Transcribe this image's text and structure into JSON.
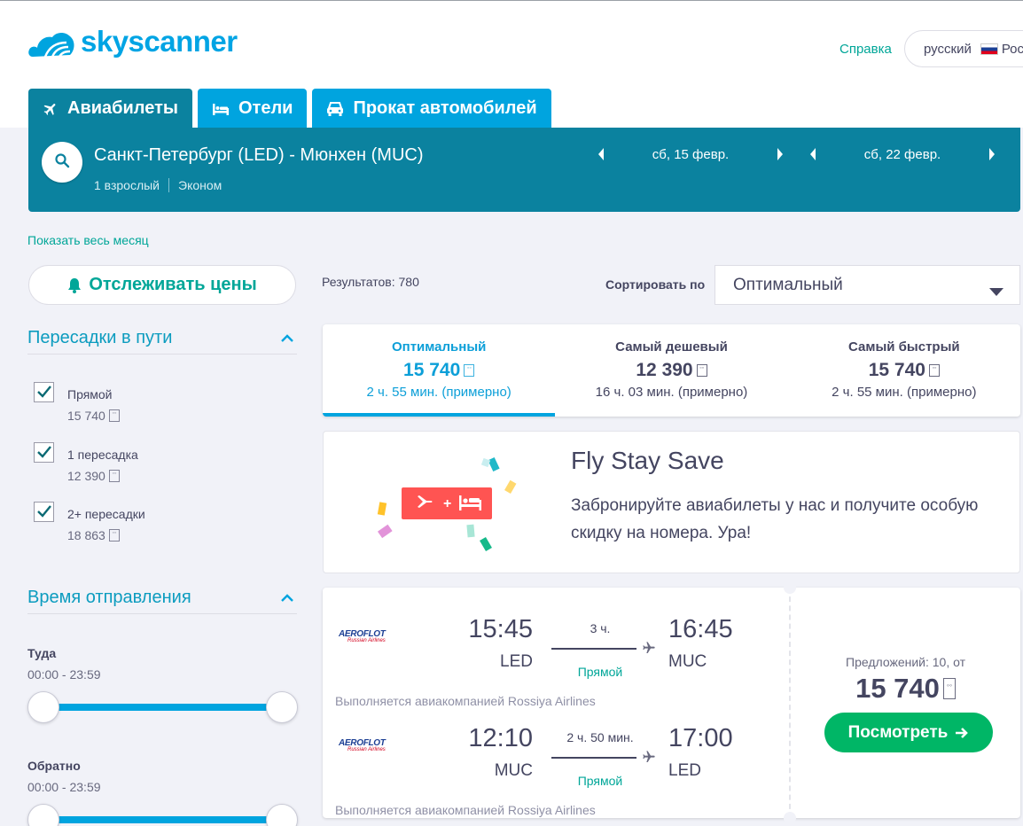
{
  "header": {
    "logo_text": "skyscanner",
    "help_link": "Справка",
    "language": "русский",
    "country_partial": "Рос"
  },
  "tabs": [
    {
      "label": "Авиабилеты",
      "icon": "plane-icon",
      "active": true
    },
    {
      "label": "Отели",
      "icon": "bed-icon",
      "active": false
    },
    {
      "label": "Прокат автомобилей",
      "icon": "car-icon",
      "active": false
    }
  ],
  "search": {
    "route": "Санкт-Петербург (LED) - Мюнхен (MUC)",
    "passengers": "1 взрослый",
    "cabin": "Эконом",
    "depart_date": "сб, 15 февр.",
    "return_date": "сб, 22 февр."
  },
  "show_month_link": "Показать весь месяц",
  "track_prices_button": "Отслеживать цены",
  "filters": {
    "stops": {
      "title": "Пересадки в пути",
      "options": [
        {
          "label": "Прямой",
          "price": "15 740",
          "checked": true
        },
        {
          "label": "1 пересадка",
          "price": "12 390",
          "checked": true
        },
        {
          "label": "2+ пересадки",
          "price": "18 863",
          "checked": true
        }
      ]
    },
    "departure_time": {
      "title": "Время отправления",
      "outbound_label": "Туда",
      "outbound_range": "00:00 - 23:59",
      "return_label": "Обратно",
      "return_range": "00:00 - 23:59"
    }
  },
  "results": {
    "count_text": "Результатов: 780",
    "sort_label": "Сортировать по",
    "sort_value": "Оптимальный"
  },
  "sort_tabs": [
    {
      "title": "Оптимальный",
      "price": "15 740",
      "duration": "2 ч. 55 мин. (примерно)",
      "active": true
    },
    {
      "title": "Самый дешевый",
      "price": "12 390",
      "duration": "16 ч. 03 мин. (примерно)",
      "active": false
    },
    {
      "title": "Самый быстрый",
      "price": "15 740",
      "duration": "2 ч. 55 мин. (примерно)",
      "active": false
    }
  ],
  "promo": {
    "title": "Fly Stay Save",
    "text": "Забронируйте авиабилеты у нас и получите особую скидку на номера. Ура!"
  },
  "result_card": {
    "legs": [
      {
        "airline": "AEROFLOT",
        "airline_sub": "Russian Airlines",
        "dep_time": "15:45",
        "dep_code": "LED",
        "duration": "3 ч.",
        "stops": "Прямой",
        "arr_time": "16:45",
        "arr_code": "MUC",
        "operated_by": "Выполняется авиакомпанией Rossiya Airlines"
      },
      {
        "airline": "AEROFLOT",
        "airline_sub": "Russian Airlines",
        "dep_time": "12:10",
        "dep_code": "MUC",
        "duration": "2 ч. 50 мин.",
        "stops": "Прямой",
        "arr_time": "17:00",
        "arr_code": "LED",
        "operated_by": "Выполняется авиакомпанией Rossiya Airlines"
      }
    ],
    "offers_text": "Предложений: 10, от",
    "price": "15 740",
    "view_button": "Посмотреть"
  },
  "colors": {
    "brand_blue": "#00a4df",
    "search_bar": "#0b829f",
    "accent_green": "#00b666",
    "link_teal": "#00a698",
    "promo_red": "#ff5452"
  }
}
